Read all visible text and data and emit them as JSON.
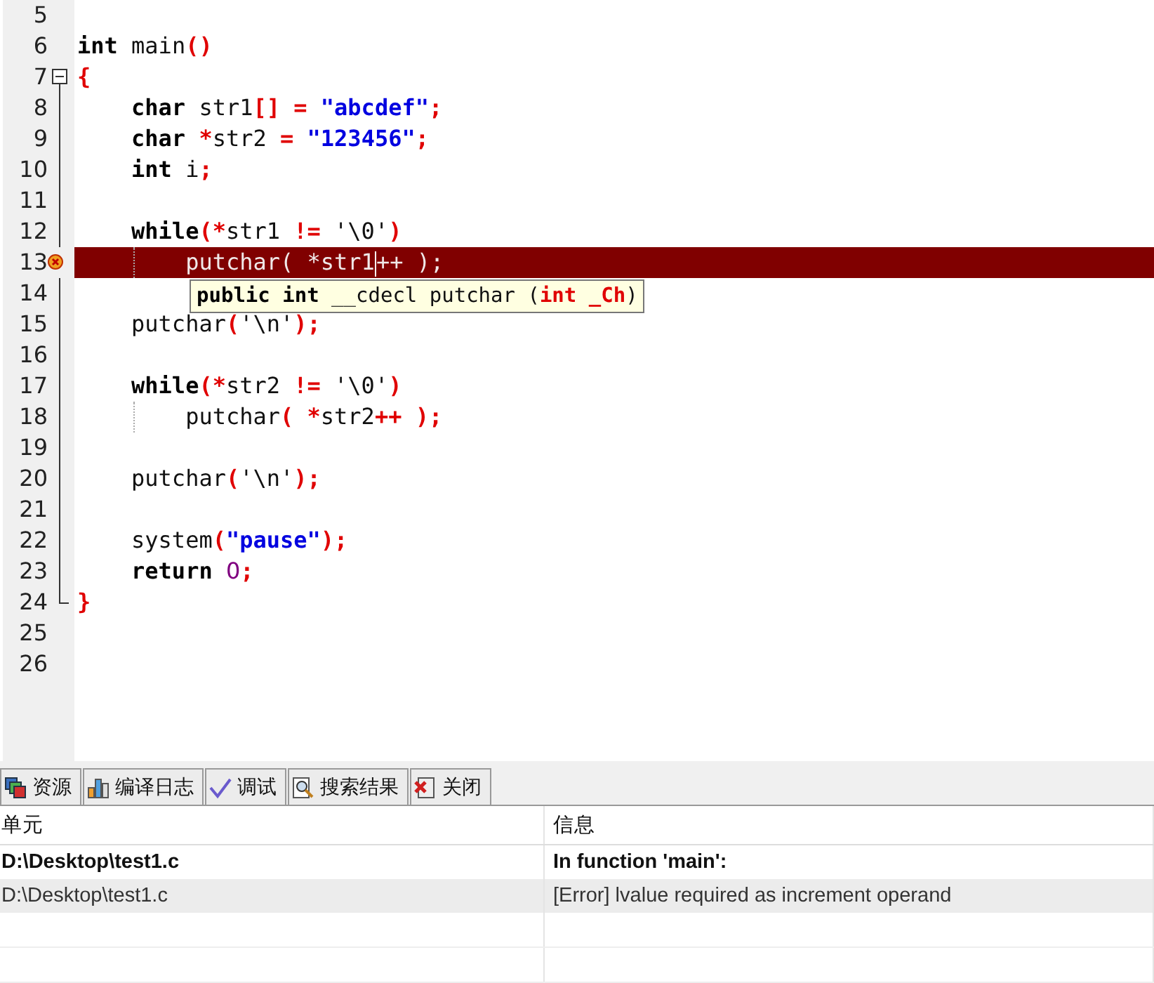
{
  "editor": {
    "lines": [
      {
        "number": "5"
      },
      {
        "number": "6",
        "tokens": [
          {
            "kind": "kw",
            "text": "int"
          },
          {
            "kind": "plain",
            "text": " main"
          },
          {
            "kind": "op",
            "text": "()"
          }
        ]
      },
      {
        "number": "7",
        "fold_start": true,
        "expanded": true,
        "tokens": [
          {
            "kind": "op",
            "text": "{"
          }
        ]
      },
      {
        "number": "8",
        "tokens": [
          {
            "kind": "kw",
            "text": "    char"
          },
          {
            "kind": "plain",
            "text": " str1"
          },
          {
            "kind": "op",
            "text": "[] = "
          },
          {
            "kind": "str",
            "text": "\"abcdef\""
          },
          {
            "kind": "op",
            "text": ";"
          }
        ]
      },
      {
        "number": "9",
        "tokens": [
          {
            "kind": "kw",
            "text": "    char "
          },
          {
            "kind": "op",
            "text": "*"
          },
          {
            "kind": "plain",
            "text": "str2 "
          },
          {
            "kind": "op",
            "text": "= "
          },
          {
            "kind": "str",
            "text": "\"123456\""
          },
          {
            "kind": "op",
            "text": ";"
          }
        ]
      },
      {
        "number": "10",
        "tokens": [
          {
            "kind": "kw",
            "text": "    int"
          },
          {
            "kind": "plain",
            "text": " i"
          },
          {
            "kind": "op",
            "text": ";"
          }
        ]
      },
      {
        "number": "11"
      },
      {
        "number": "12",
        "tokens": [
          {
            "kind": "kw",
            "text": "    while"
          },
          {
            "kind": "op",
            "text": "(*"
          },
          {
            "kind": "plain",
            "text": "str1 "
          },
          {
            "kind": "op",
            "text": "!="
          },
          {
            "kind": "plain",
            "text": " '\\0'"
          },
          {
            "kind": "op",
            "text": ")"
          }
        ]
      },
      {
        "number": "13",
        "error": true,
        "guide": true,
        "tokens": [
          {
            "kind": "plain",
            "text": "        putchar( "
          },
          {
            "kind": "op",
            "text": "*"
          },
          {
            "kind": "plain",
            "text": "str1",
            "caret": true
          },
          {
            "kind": "op",
            "text": "++"
          },
          {
            "kind": "plain",
            "text": " );"
          }
        ]
      },
      {
        "number": "14"
      },
      {
        "number": "15",
        "tokens": [
          {
            "kind": "plain",
            "text": "    putchar"
          },
          {
            "kind": "op",
            "text": "("
          },
          {
            "kind": "plain",
            "text": "'\\n'"
          },
          {
            "kind": "op",
            "text": ");"
          }
        ]
      },
      {
        "number": "16"
      },
      {
        "number": "17",
        "tokens": [
          {
            "kind": "kw",
            "text": "    while"
          },
          {
            "kind": "op",
            "text": "(*"
          },
          {
            "kind": "plain",
            "text": "str2 "
          },
          {
            "kind": "op",
            "text": "!="
          },
          {
            "kind": "plain",
            "text": " '\\0'"
          },
          {
            "kind": "op",
            "text": ")"
          }
        ]
      },
      {
        "number": "18",
        "guide": true,
        "tokens": [
          {
            "kind": "plain",
            "text": "        putchar"
          },
          {
            "kind": "op",
            "text": "( *"
          },
          {
            "kind": "plain",
            "text": "str2"
          },
          {
            "kind": "op",
            "text": "++ );"
          }
        ]
      },
      {
        "number": "19"
      },
      {
        "number": "20",
        "tokens": [
          {
            "kind": "plain",
            "text": "    putchar"
          },
          {
            "kind": "op",
            "text": "("
          },
          {
            "kind": "plain",
            "text": "'\\n'"
          },
          {
            "kind": "op",
            "text": ");"
          }
        ]
      },
      {
        "number": "21"
      },
      {
        "number": "22",
        "tokens": [
          {
            "kind": "plain",
            "text": "    system"
          },
          {
            "kind": "op",
            "text": "("
          },
          {
            "kind": "str",
            "text": "\"pause\""
          },
          {
            "kind": "op",
            "text": ");"
          }
        ]
      },
      {
        "number": "23",
        "tokens": [
          {
            "kind": "kw",
            "text": "    return "
          },
          {
            "kind": "num",
            "text": "0"
          },
          {
            "kind": "op",
            "text": ";"
          }
        ]
      },
      {
        "number": "24",
        "fold_end": true,
        "tokens": [
          {
            "kind": "op",
            "text": "}"
          }
        ]
      },
      {
        "number": "25"
      },
      {
        "number": "26"
      }
    ],
    "tooltip": {
      "tokens": [
        {
          "kind": "kw",
          "text": "public int"
        },
        {
          "kind": "plain",
          "text": " __cdecl putchar ("
        },
        {
          "kind": "op",
          "text": "int _Ch"
        },
        {
          "kind": "plain",
          "text": ")"
        }
      ]
    }
  },
  "tabs": [
    {
      "label": "资源",
      "kind": "resources"
    },
    {
      "label": "编译日志",
      "kind": "log"
    },
    {
      "label": "调试",
      "kind": "debug"
    },
    {
      "label": "搜索结果",
      "kind": "search"
    },
    {
      "label": "关闭",
      "kind": "close"
    }
  ],
  "table": {
    "columns": [
      "单元",
      "信息"
    ],
    "rows": [
      {
        "cells": [
          "D:\\Desktop\\test1.c",
          "In function 'main':"
        ],
        "bold": true,
        "selected": false
      },
      {
        "cells": [
          "D:\\Desktop\\test1.c",
          "[Error] lvalue required as increment operand"
        ],
        "bold": false,
        "selected": true
      }
    ]
  }
}
